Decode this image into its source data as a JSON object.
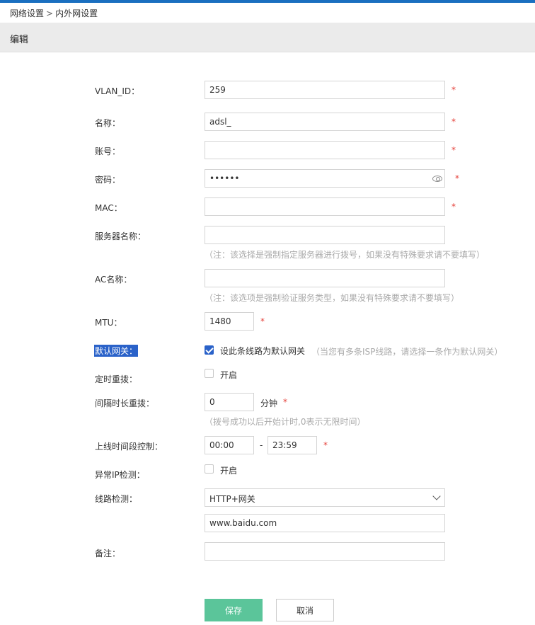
{
  "breadcrumb": {
    "parent": "网络设置",
    "separator": ">",
    "current": "内外网设置"
  },
  "section": {
    "title": "编辑"
  },
  "form": {
    "vlan_id": {
      "label": "VLAN_ID：",
      "value": "259",
      "required": "*"
    },
    "name": {
      "label": "名称：",
      "value": "adsl_",
      "required": "*"
    },
    "account": {
      "label": "账号：",
      "value": "",
      "required": "*"
    },
    "password": {
      "label": "密码：",
      "value": "••••••",
      "required": "*",
      "icon": "eye-icon"
    },
    "mac": {
      "label": "MAC：",
      "value": "",
      "required": "*"
    },
    "server_name": {
      "label": "服务器名称：",
      "value": "",
      "note": "（注：该选择是强制指定服务器进行拨号，如果没有特殊要求请不要填写）"
    },
    "ac_name": {
      "label": "AC名称：",
      "value": "",
      "note": "（注：该选项是强制验证服务类型，如果没有特殊要求请不要填写）"
    },
    "mtu": {
      "label": "MTU：",
      "value": "1480",
      "required": "*"
    },
    "default_gateway": {
      "label": "默认网关：",
      "checkbox_label": "设此条线路为默认网关",
      "checked": true,
      "note": "（当您有多条ISP线路，请选择一条作为默认网关）"
    },
    "scheduled_redial": {
      "label": "定时重拨：",
      "checkbox_label": "开启",
      "checked": false
    },
    "interval_redial": {
      "label": "间隔时长重拨：",
      "value": "0",
      "unit": "分钟",
      "required": "*",
      "note": "（拨号成功以后开始计时,0表示无限时间）"
    },
    "online_time": {
      "label": "上线时间段控制：",
      "start": "00:00",
      "separator": "-",
      "end": "23:59",
      "required": "*"
    },
    "abnormal_ip": {
      "label": "异常IP检测：",
      "checkbox_label": "开启",
      "checked": false
    },
    "line_check": {
      "label": "线路检测：",
      "selected": "HTTP+网关",
      "url": "www.baidu.com"
    },
    "remark": {
      "label": "备注：",
      "value": ""
    }
  },
  "buttons": {
    "save": "保存",
    "cancel": "取消"
  },
  "colors": {
    "top_bar": "#1a6fc0",
    "save_button": "#5bc59a",
    "required": "#e5413a",
    "checkbox_checked": "#2a62c9"
  }
}
